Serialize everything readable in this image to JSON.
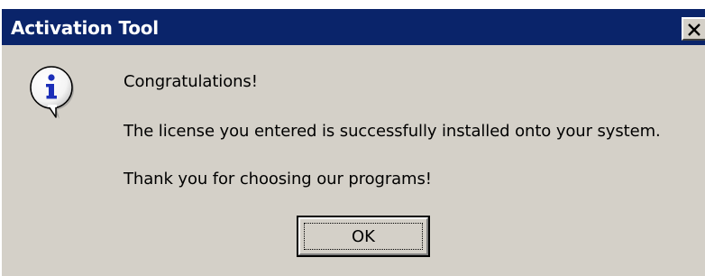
{
  "window": {
    "title": "Activation Tool",
    "close_icon": "close-icon"
  },
  "message": {
    "icon": "info-icon",
    "line1": "Congratulations!",
    "line2": "The license you entered is successfully installed onto your system.",
    "line3": "Thank you for choosing our programs!"
  },
  "buttons": {
    "ok_label": "OK"
  },
  "colors": {
    "titlebar": "#0a246a",
    "dialog_bg": "#d4d0c8",
    "title_text": "#ffffff"
  }
}
